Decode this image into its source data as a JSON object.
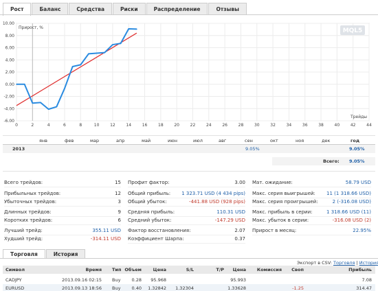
{
  "tabs": [
    "Рост",
    "Баланс",
    "Средства",
    "Риски",
    "Распределение",
    "Отзывы"
  ],
  "chart_data": {
    "type": "line",
    "ylabel": "Прирост, %",
    "xlabel": "Трейды",
    "watermark": "MQL5",
    "xlim": [
      0,
      44
    ],
    "ylim": [
      -6,
      10
    ],
    "x_ticks": [
      0,
      2,
      4,
      6,
      8,
      10,
      12,
      14,
      16,
      18,
      20,
      22,
      24,
      26,
      28,
      30,
      32,
      34,
      36,
      38,
      40,
      42,
      44
    ],
    "y_ticks": [
      "10.00",
      "8.00",
      "6.00",
      "4.00",
      "2.00",
      "0.00",
      "-2.00",
      "-4.00",
      "-6.00"
    ],
    "series": [
      {
        "color": "#2a8be0",
        "x": [
          0,
          1,
          2,
          3,
          4,
          5,
          6,
          7,
          8,
          9,
          10,
          11,
          12,
          13,
          14,
          15
        ],
        "values": [
          0.0,
          0.0,
          -3.1,
          -3.0,
          -4.1,
          -3.7,
          -0.7,
          2.9,
          3.2,
          5.0,
          5.1,
          5.2,
          6.5,
          6.7,
          9.1,
          9.05
        ]
      }
    ],
    "trendline": {
      "color": "#e03030",
      "x": [
        0,
        15
      ],
      "values": [
        -3.5,
        8.4
      ]
    }
  },
  "months": {
    "headers": [
      "янв",
      "фев",
      "мар",
      "апр",
      "май",
      "июн",
      "июл",
      "авг",
      "сен",
      "окт",
      "ноя",
      "дек",
      "год"
    ],
    "year": "2013",
    "sep_value": "9.05%",
    "year_total": "9.05%",
    "total_label": "Всего:",
    "total_value": "9.05%"
  },
  "stats": {
    "col1": [
      {
        "label": "Всего трейдов:",
        "value": "15"
      },
      {
        "label": "Прибыльных трейдов:",
        "value": "12"
      },
      {
        "label": "Убыточных трейдов:",
        "value": "3"
      },
      {
        "label": "Длинных трейдов:",
        "value": "9"
      },
      {
        "label": "Коротких трейдов:",
        "value": "6"
      },
      {
        "label": "Лучший трейд:",
        "value": "355.11 USD"
      },
      {
        "label": "Худший трейд:",
        "value": "-314.11 USD"
      }
    ],
    "col2": [
      {
        "label": "Профит фактор:",
        "value": "3.00"
      },
      {
        "label": "Общий прибыль:",
        "value": "1 323.71 USD (4 434 pips)"
      },
      {
        "label": "Общий убыток:",
        "value": "-441.88 USD (928 pips)"
      },
      {
        "label": "Средняя прибыль:",
        "value": "110.31 USD"
      },
      {
        "label": "Средний убыток:",
        "value": "-147.29 USD"
      },
      {
        "label": "Фактор восстановления:",
        "value": "2.07"
      },
      {
        "label": "Коэффициент Шарпа:",
        "value": "0.37"
      }
    ],
    "col3": [
      {
        "label": "Мат. ожидание:",
        "value": "58.79 USD"
      },
      {
        "label": "Макс. серия выигрышей:",
        "value": "11 (1 318.66 USD)"
      },
      {
        "label": "Макс. серия проигрышей:",
        "value": "2 (-316.08 USD)"
      },
      {
        "label": "Макс. прибыль в серии:",
        "value": "1 318.66 USD (11)"
      },
      {
        "label": "Макс. убыток в серии:",
        "value": "-316.08 USD (2)"
      },
      {
        "label": "Прирост в месяц:",
        "value": "22.95%"
      }
    ]
  },
  "bottom_tabs": [
    "Торговля",
    "История"
  ],
  "export": {
    "label": "Экспорт в CSV:",
    "trading": "Торговля",
    "sep": "|",
    "history": "История"
  },
  "table": {
    "headers": [
      "Символ",
      "Время",
      "Тип",
      "Объем",
      "Цена",
      "S/L",
      "T/P",
      "Цена",
      "Комиссия",
      "Своп",
      "Прибыль"
    ],
    "rows": [
      [
        "CADJPY",
        "2013.09.16 02:15",
        "Buy",
        "0.28",
        "95.968",
        "",
        "",
        "95.993",
        "",
        "",
        "7.08"
      ],
      [
        "EURUSD",
        "2013.09.13 18:56",
        "Buy",
        "0.40",
        "1.32842",
        "1.32304",
        "",
        "1.33628",
        "",
        "-1.25",
        "314.47"
      ]
    ]
  }
}
